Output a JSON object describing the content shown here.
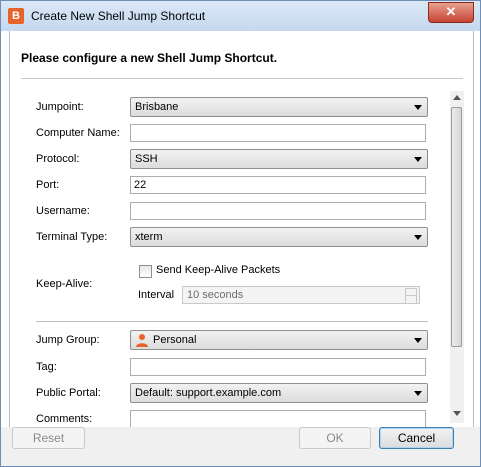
{
  "window": {
    "title": "Create New Shell Jump Shortcut",
    "app_icon_letter": "B",
    "close_glyph": "✕"
  },
  "heading": "Please configure a new Shell Jump Shortcut.",
  "form": {
    "jumpoint": {
      "label": "Jumpoint:",
      "value": "Brisbane"
    },
    "computer_name": {
      "label": "Computer Name:",
      "value": ""
    },
    "protocol": {
      "label": "Protocol:",
      "value": "SSH"
    },
    "port": {
      "label": "Port:",
      "value": "22"
    },
    "username": {
      "label": "Username:",
      "value": ""
    },
    "terminal_type": {
      "label": "Terminal Type:",
      "value": "xterm"
    },
    "keep_alive": {
      "label": "Keep-Alive:",
      "checkbox_label": "Send Keep-Alive Packets",
      "checked": false,
      "interval_label": "Interval",
      "interval_value": "10 seconds"
    },
    "jump_group": {
      "label": "Jump Group:",
      "value": "Personal",
      "icon": "person-icon"
    },
    "tag": {
      "label": "Tag:",
      "value": ""
    },
    "public_portal": {
      "label": "Public Portal:",
      "value": "Default: support.example.com"
    },
    "comments": {
      "label": "Comments:",
      "value": ""
    }
  },
  "buttons": {
    "reset": "Reset",
    "ok": "OK",
    "cancel": "Cancel"
  },
  "colors": {
    "accent": "#e8632a",
    "close": "#c74432"
  }
}
